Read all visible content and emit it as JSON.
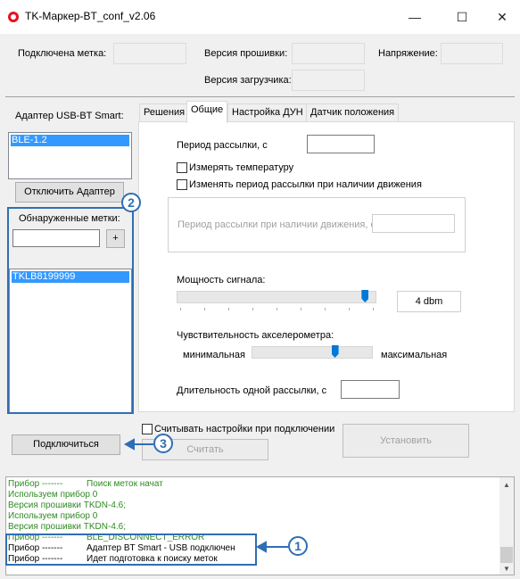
{
  "window": {
    "title": "TK-Маркер-BT_conf_v2.06",
    "minimize": "—",
    "maximize": "☐",
    "close": "✕"
  },
  "header": {
    "tag_label": "Подключена метка:",
    "firmware_label": "Версия прошивки:",
    "voltage_label": "Напряжение:",
    "bootloader_label": "Версия загрузчика:"
  },
  "left": {
    "adapter_label": "Адаптер USB-BT Smart:",
    "adapter_items": [
      "BLE-1.2"
    ],
    "disconnect_button": "Отключить Адаптер",
    "found_label": "Обнаруженные метки:",
    "add_button": "+",
    "found_items": [
      "TKLB8199999"
    ],
    "connect_button": "Подключиться"
  },
  "tabs": [
    "Решения",
    "Общие",
    "Настройка ДУН",
    "Датчик положения"
  ],
  "active_tab": "Общие",
  "general": {
    "period_label": "Период рассылки, с",
    "measure_temp": "Измерять температуру",
    "change_period": "Изменять период рассылки при наличии движения",
    "motion_period_label": "Период рассылки при наличии движения, с",
    "power_label": "Мощность сигнала:",
    "power_value": "4 dbm",
    "power_level": 0.96,
    "sensitivity_label": "Чувствительность акселерометра:",
    "sens_min": "минимальная",
    "sens_max": "максимальная",
    "sens_level": 0.7,
    "duration_label": "Длительность одной рассылки, с"
  },
  "bottom": {
    "read_on_connect": "Считывать настройки при подключении",
    "read_button": "Считать",
    "set_button": "Установить"
  },
  "log": [
    {
      "a": "Прибор -------",
      "b": "Поиск меток начат",
      "green": true
    },
    {
      "a": "Используем прибор  0",
      "b": "",
      "green": true
    },
    {
      "a": "Версия прошивки TKDN-4.6;",
      "b": "",
      "green": true
    },
    {
      "a": "Используем прибор  0",
      "b": "",
      "green": true
    },
    {
      "a": "Версия прошивки TKDN-4.6;",
      "b": "",
      "green": true
    },
    {
      "a": "Прибор -------",
      "b": "BLE_DISCONNECT_ERROR",
      "green": true
    },
    {
      "a": "Прибор -------",
      "b": "Адаптер BT Smart - USB подключен",
      "green": false
    },
    {
      "a": "Прибор -------",
      "b": "Идет подготовка к поиску меток",
      "green": false
    }
  ],
  "callouts": [
    "1",
    "2",
    "3"
  ],
  "colors": {
    "accent": "#2f6eb5",
    "selection": "#3399ff",
    "log_green": "#2e8b22"
  }
}
